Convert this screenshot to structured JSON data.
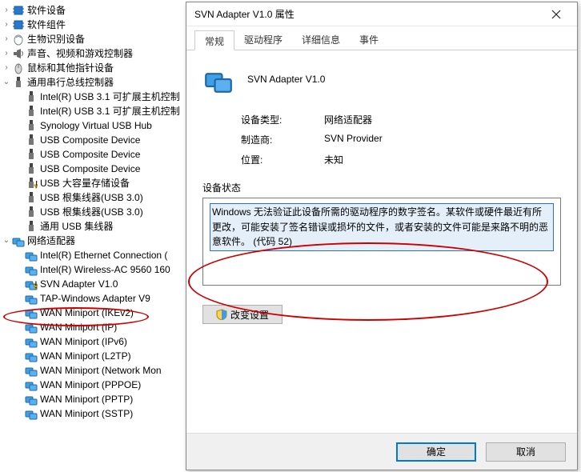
{
  "tree": {
    "items": [
      {
        "d": 0,
        "tw": ">",
        "icon": "chip",
        "label": "软件设备"
      },
      {
        "d": 0,
        "tw": ">",
        "icon": "chip",
        "label": "软件组件"
      },
      {
        "d": 0,
        "tw": ">",
        "icon": "finger",
        "label": "生物识别设备"
      },
      {
        "d": 0,
        "tw": ">",
        "icon": "speaker",
        "label": "声音、视频和游戏控制器"
      },
      {
        "d": 0,
        "tw": ">",
        "icon": "mouse",
        "label": "鼠标和其他指针设备"
      },
      {
        "d": 0,
        "tw": "v",
        "icon": "usb",
        "label": "通用串行总线控制器"
      },
      {
        "d": 1,
        "tw": "",
        "icon": "usbp",
        "label": "Intel(R) USB 3.1 可扩展主机控制"
      },
      {
        "d": 1,
        "tw": "",
        "icon": "usbp",
        "label": "Intel(R) USB 3.1 可扩展主机控制"
      },
      {
        "d": 1,
        "tw": "",
        "icon": "usbp",
        "label": "Synology Virtual USB Hub"
      },
      {
        "d": 1,
        "tw": "",
        "icon": "usbp",
        "label": "USB Composite Device"
      },
      {
        "d": 1,
        "tw": "",
        "icon": "usbp",
        "label": "USB Composite Device"
      },
      {
        "d": 1,
        "tw": "",
        "icon": "usbp",
        "label": "USB Composite Device"
      },
      {
        "d": 1,
        "tw": "",
        "icon": "usbw",
        "label": "USB 大容量存储设备"
      },
      {
        "d": 1,
        "tw": "",
        "icon": "usbp",
        "label": "USB 根集线器(USB 3.0)"
      },
      {
        "d": 1,
        "tw": "",
        "icon": "usbp",
        "label": "USB 根集线器(USB 3.0)"
      },
      {
        "d": 1,
        "tw": "",
        "icon": "usbp",
        "label": "通用 USB 集线器"
      },
      {
        "d": 0,
        "tw": "v",
        "icon": "net",
        "label": "网络适配器"
      },
      {
        "d": 1,
        "tw": "",
        "icon": "net",
        "label": "Intel(R) Ethernet Connection ("
      },
      {
        "d": 1,
        "tw": "",
        "icon": "net",
        "label": "Intel(R) Wireless-AC 9560 160"
      },
      {
        "d": 1,
        "tw": "",
        "icon": "netw",
        "label": "SVN Adapter V1.0"
      },
      {
        "d": 1,
        "tw": "",
        "icon": "net",
        "label": "TAP-Windows Adapter V9"
      },
      {
        "d": 1,
        "tw": "",
        "icon": "net",
        "label": "WAN Miniport (IKEv2)"
      },
      {
        "d": 1,
        "tw": "",
        "icon": "net",
        "label": "WAN Miniport (IP)"
      },
      {
        "d": 1,
        "tw": "",
        "icon": "net",
        "label": "WAN Miniport (IPv6)"
      },
      {
        "d": 1,
        "tw": "",
        "icon": "net",
        "label": "WAN Miniport (L2TP)"
      },
      {
        "d": 1,
        "tw": "",
        "icon": "net",
        "label": "WAN Miniport (Network Mon"
      },
      {
        "d": 1,
        "tw": "",
        "icon": "net",
        "label": "WAN Miniport (PPPOE)"
      },
      {
        "d": 1,
        "tw": "",
        "icon": "net",
        "label": "WAN Miniport (PPTP)"
      },
      {
        "d": 1,
        "tw": "",
        "icon": "net",
        "label": "WAN Miniport (SSTP)"
      }
    ]
  },
  "dialog": {
    "title": "SVN Adapter V1.0 属性",
    "tabs": [
      "常规",
      "驱动程序",
      "详细信息",
      "事件"
    ],
    "deviceName": "SVN Adapter V1.0",
    "rows": {
      "type_k": "设备类型:",
      "type_v": "网络适配器",
      "mfr_k": "制造商:",
      "mfr_v": "SVN Provider",
      "loc_k": "位置:",
      "loc_v": "未知"
    },
    "status_label": "设备状态",
    "status_text": "Windows 无法验证此设备所需的驱动程序的数字签名。某软件或硬件最近有所更改，可能安装了签名错误或损坏的文件，或者安装的文件可能是来路不明的恶意软件。 (代码 52)",
    "change_btn": "改变设置",
    "ok_btn": "确定",
    "cancel_btn": "取消"
  }
}
